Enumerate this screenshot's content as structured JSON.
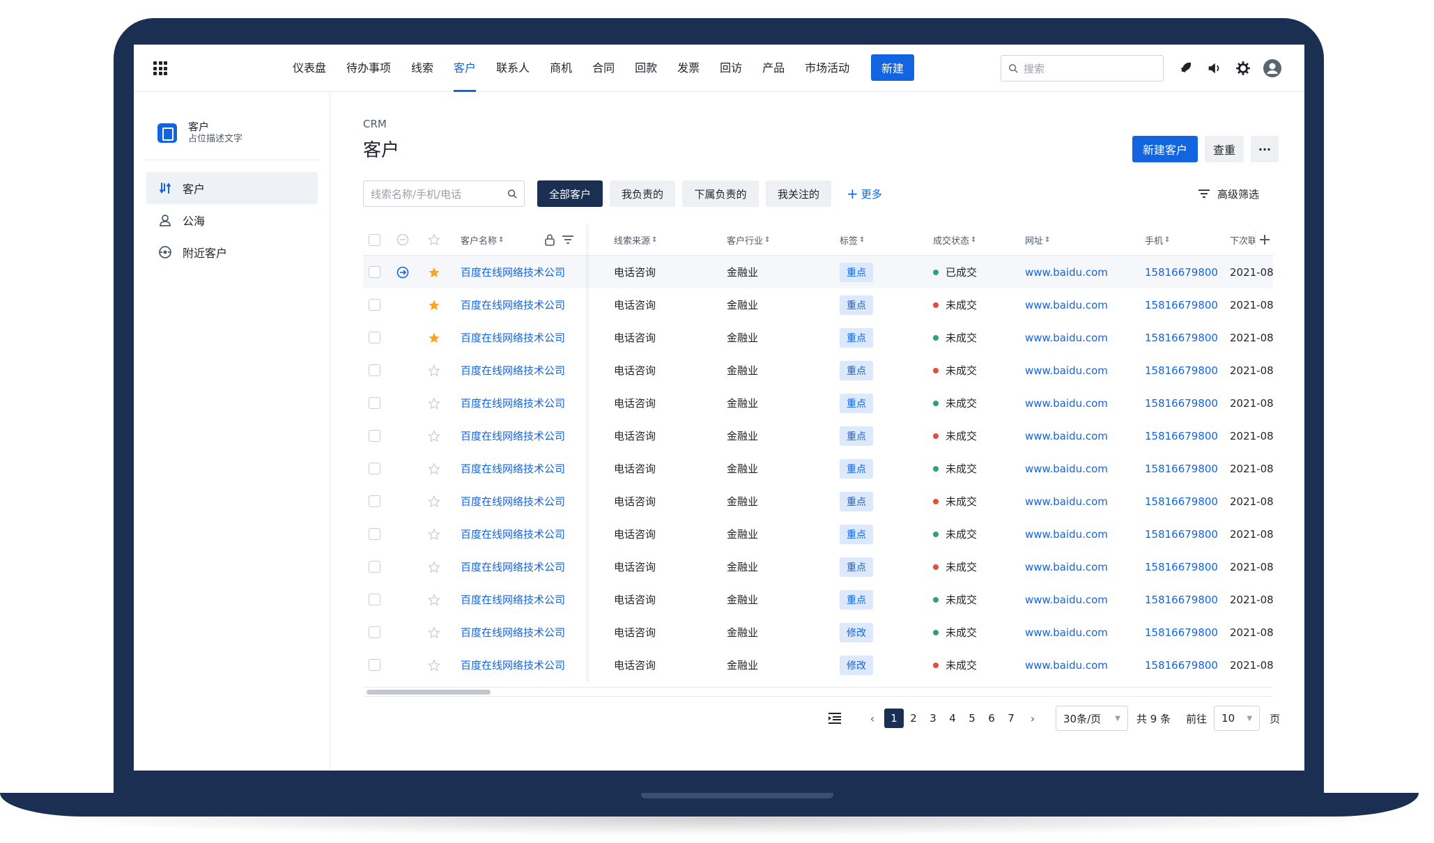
{
  "nav": {
    "items": [
      "仪表盘",
      "待办事项",
      "线索",
      "客户",
      "联系人",
      "商机",
      "合同",
      "回款",
      "发票",
      "回访",
      "产品",
      "市场活动"
    ],
    "active_index": 3,
    "new_button": "新建",
    "search_placeholder": "搜索"
  },
  "sidebar": {
    "title": "客户",
    "subtitle": "占位描述文字",
    "items": [
      {
        "label": "客户",
        "icon": "route-icon",
        "active": true
      },
      {
        "label": "公海",
        "icon": "users-icon",
        "active": false
      },
      {
        "label": "附近客户",
        "icon": "location-icon",
        "active": false
      }
    ]
  },
  "main": {
    "breadcrumb": "CRM",
    "title": "客户",
    "new_customer_button": "新建客户",
    "dedupe_button": "查重",
    "more_button": "···",
    "search_placeholder": "线索名称/手机/电话",
    "filters": [
      "全部客户",
      "我负责的",
      "下属负责的",
      "我关注的"
    ],
    "active_filter": 0,
    "more_filters": "更多",
    "advanced_filter": "高级筛选"
  },
  "table": {
    "columns": [
      "客户名称",
      "线索来源",
      "客户行业",
      "标签",
      "成交状态",
      "网址",
      "手机",
      "下次联"
    ],
    "rows": [
      {
        "name": "百度在线网络技术公司",
        "source": "电话咨询",
        "industry": "金融业",
        "tag": "重点",
        "status": "已成交",
        "status_color": "#2ba471",
        "url": "www.baidu.com",
        "phone": "15816679800",
        "next": "2021-08",
        "starred": true,
        "hover": true
      },
      {
        "name": "百度在线网络技术公司",
        "source": "电话咨询",
        "industry": "金融业",
        "tag": "重点",
        "status": "未成交",
        "status_color": "#e34d3b",
        "url": "www.baidu.com",
        "phone": "15816679800",
        "next": "2021-08",
        "starred": true,
        "hover": false
      },
      {
        "name": "百度在线网络技术公司",
        "source": "电话咨询",
        "industry": "金融业",
        "tag": "重点",
        "status": "未成交",
        "status_color": "#2ba471",
        "url": "www.baidu.com",
        "phone": "15816679800",
        "next": "2021-08",
        "starred": true,
        "hover": false
      },
      {
        "name": "百度在线网络技术公司",
        "source": "电话咨询",
        "industry": "金融业",
        "tag": "重点",
        "status": "未成交",
        "status_color": "#e34d3b",
        "url": "www.baidu.com",
        "phone": "15816679800",
        "next": "2021-08",
        "starred": false,
        "hover": false
      },
      {
        "name": "百度在线网络技术公司",
        "source": "电话咨询",
        "industry": "金融业",
        "tag": "重点",
        "status": "未成交",
        "status_color": "#2ba471",
        "url": "www.baidu.com",
        "phone": "15816679800",
        "next": "2021-08",
        "starred": false,
        "hover": false
      },
      {
        "name": "百度在线网络技术公司",
        "source": "电话咨询",
        "industry": "金融业",
        "tag": "重点",
        "status": "未成交",
        "status_color": "#e34d3b",
        "url": "www.baidu.com",
        "phone": "15816679800",
        "next": "2021-08",
        "starred": false,
        "hover": false
      },
      {
        "name": "百度在线网络技术公司",
        "source": "电话咨询",
        "industry": "金融业",
        "tag": "重点",
        "status": "未成交",
        "status_color": "#2ba471",
        "url": "www.baidu.com",
        "phone": "15816679800",
        "next": "2021-08",
        "starred": false,
        "hover": false
      },
      {
        "name": "百度在线网络技术公司",
        "source": "电话咨询",
        "industry": "金融业",
        "tag": "重点",
        "status": "未成交",
        "status_color": "#e34d3b",
        "url": "www.baidu.com",
        "phone": "15816679800",
        "next": "2021-08",
        "starred": false,
        "hover": false
      },
      {
        "name": "百度在线网络技术公司",
        "source": "电话咨询",
        "industry": "金融业",
        "tag": "重点",
        "status": "未成交",
        "status_color": "#2ba471",
        "url": "www.baidu.com",
        "phone": "15816679800",
        "next": "2021-08",
        "starred": false,
        "hover": false
      },
      {
        "name": "百度在线网络技术公司",
        "source": "电话咨询",
        "industry": "金融业",
        "tag": "重点",
        "status": "未成交",
        "status_color": "#e34d3b",
        "url": "www.baidu.com",
        "phone": "15816679800",
        "next": "2021-08",
        "starred": false,
        "hover": false
      },
      {
        "name": "百度在线网络技术公司",
        "source": "电话咨询",
        "industry": "金融业",
        "tag": "重点",
        "status": "未成交",
        "status_color": "#2ba471",
        "url": "www.baidu.com",
        "phone": "15816679800",
        "next": "2021-08",
        "starred": false,
        "hover": false
      },
      {
        "name": "百度在线网络技术公司",
        "source": "电话咨询",
        "industry": "金融业",
        "tag": "修改",
        "status": "未成交",
        "status_color": "#2ba471",
        "url": "www.baidu.com",
        "phone": "15816679800",
        "next": "2021-08",
        "starred": false,
        "hover": false
      },
      {
        "name": "百度在线网络技术公司",
        "source": "电话咨询",
        "industry": "金融业",
        "tag": "修改",
        "status": "未成交",
        "status_color": "#e34d3b",
        "url": "www.baidu.com",
        "phone": "15816679800",
        "next": "2021-08",
        "starred": false,
        "hover": false
      }
    ]
  },
  "pagination": {
    "pages": [
      "1",
      "2",
      "3",
      "4",
      "5",
      "6",
      "7"
    ],
    "active_page": "1",
    "page_size": "30条/页",
    "total": "共 9 条",
    "goto_label": "前往",
    "goto_value": "10",
    "page_suffix": "页"
  },
  "colors": {
    "primary": "#1264e0",
    "navy": "#1b2f52",
    "star": "#f5a623"
  }
}
